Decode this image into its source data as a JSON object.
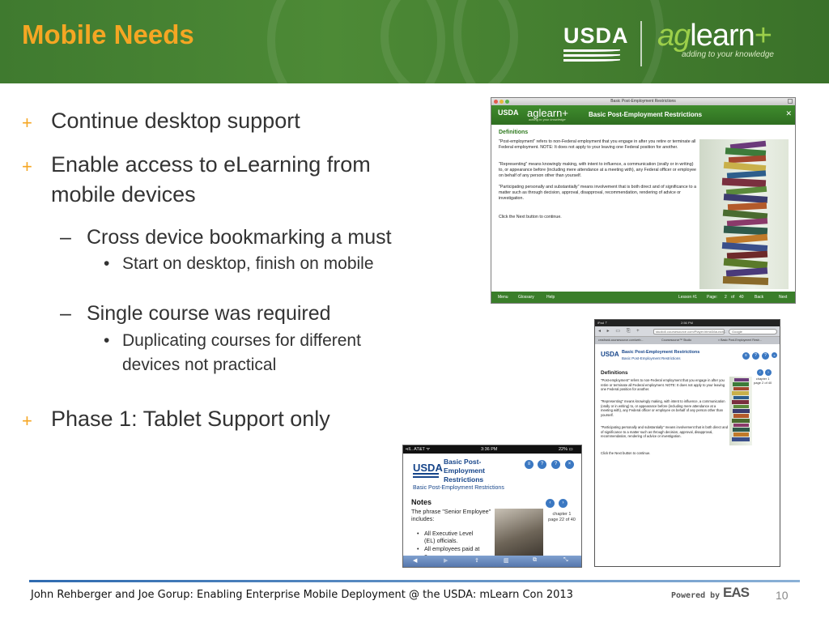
{
  "slide": {
    "title": "Mobile Needs",
    "page_number": "10",
    "footer": "John Rehberger  and Joe Gorup: Enabling Enterprise Mobile Deployment  @ the USDA: mLearn Con 2013",
    "powered_by": "Powered by",
    "powered_logo": "EAS",
    "usda_logo": "USDA",
    "aglearn": {
      "ag": "ag",
      "learn": "learn",
      "plus": "+",
      "tagline": "adding to your knowledge"
    },
    "colors": {
      "header_green": "#4d8a36",
      "title_orange": "#f5a623",
      "bullet_orange": "#f5a623"
    }
  },
  "bullets": [
    {
      "mark": "+",
      "text": "Continue desktop support"
    },
    {
      "mark": "+",
      "text_line1": "Enable access to eLearning from",
      "text_line2": "mobile devices"
    },
    {
      "mark": "–",
      "text": "Cross device bookmarking a must"
    },
    {
      "mark": "•",
      "text": "Start on desktop, finish on mobile"
    },
    {
      "mark": "–",
      "text": "Single course was required"
    },
    {
      "mark": "•",
      "text_line1": "Duplicating courses for different",
      "text_line2": "devices not practical"
    },
    {
      "mark": "+",
      "text": "Phase 1: Tablet Support only"
    }
  ],
  "desktop_shot": {
    "window_title": "Basic Post-Employment Restrictions",
    "usda": "USDA",
    "aglearn": "aglearn+",
    "aglearn_tag": "adding to your knowledge",
    "course_title": "Basic Post-Employment Restrictions",
    "close": "✕",
    "heading": "Definitions",
    "p1": "\"Post-employment\" refers to non-Federal employment that you engage in after you retire or terminate all Federal employment. NOTE: It does not apply to your leaving one Federal position for another.",
    "p2": "\"Representing\" means knowingly making, with intent to influence, a communication (orally or in writing) to, or appearance before (including mere attendance at a meeting with), any Federal officer or employee on behalf of any person other than yourself.",
    "p3": "\"Participating personally and substantially\" means involvement that is both direct and of significance to a matter such as through decision, approval, disapproval, recommendation, rendering of advice or investigation.",
    "p4": "Click the Next button to continue.",
    "footer": {
      "menu": "Menu",
      "glossary": "Glossary",
      "help": "Help",
      "lesson": "Lesson #1",
      "page_label": "Page:",
      "page": "2",
      "of": "of",
      "total": "40",
      "back": "Back",
      "next": "Next"
    }
  },
  "tablet_shot": {
    "status_left": "iPad ⇡",
    "status_time": "2:56 PM",
    "url": "studio5.coursesource.com/Player.htm#3/launch...",
    "search": "Google",
    "nav_icons": "◂ ▸ ▭ ⎘ +",
    "tab1": "cmsfrank.coursesource.com/web...",
    "tab2": "Coursesource™ Studio",
    "tab3": "× Basic Post-Employment Restr...",
    "usda": "USDA",
    "title": "Basic Post-Employment Restrictions",
    "subtitle": "Basic Post-Employment Restrictions",
    "heading": "Definitions",
    "p1": "\"Post-employment\" refers to non-Federal employment that you engage in after you retire or terminate all Federal employment. NOTE: It does not apply to your leaving one Federal position for another.",
    "p2": "\"Representing\" means knowingly making, with intent to influence, a communication (orally or in writing) to, or appearance before (including mere attendance at a meeting with), any Federal officer or employee on behalf of any person other than yourself.",
    "p3": "\"Participating personally and substantially\" means involvement that is both direct and of significance to a matter such as through decision, approval, disapproval, recommendation, rendering of advice or investigation.",
    "p4": "Click the Next button to continue.",
    "chapter": "chapter 1",
    "page": "page 2 of 40"
  },
  "phone_shot": {
    "carrier": "•ıll.. AT&T ᯤ",
    "time": "3:36 PM",
    "battery": "22% ▭",
    "usda": "USDA",
    "title": "Basic Post-Employment Restrictions",
    "subtitle": "Basic Post-Employment Restrictions",
    "heading": "Notes",
    "p1": "The phrase \"Senior Employee\" includes:",
    "li1": "All Executive Level (EL) officials.",
    "li2": "All employees paid at a",
    "chapter": "chapter 1",
    "page": "page 22 of 40",
    "toolbar": [
      "◀",
      "▶",
      "⇪",
      "▥",
      "⧉",
      "⤡"
    ]
  }
}
